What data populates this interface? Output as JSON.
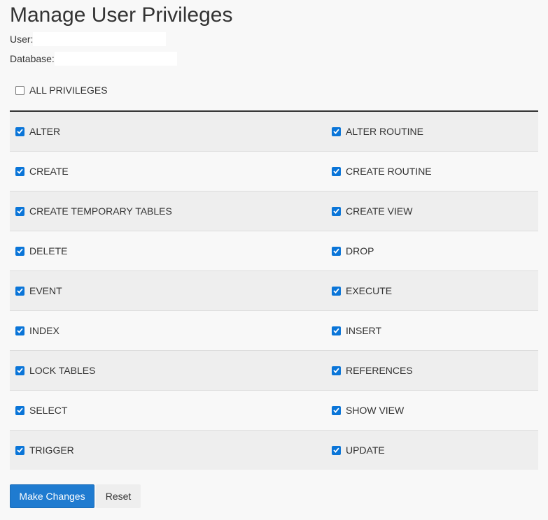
{
  "page": {
    "title": "Manage User Privileges"
  },
  "info": {
    "user_label": "User:",
    "user_value": "",
    "database_label": "Database:",
    "database_value": ""
  },
  "all_privileges": {
    "label": "ALL PRIVILEGES",
    "checked": false
  },
  "privileges": [
    {
      "left": {
        "label": "ALTER",
        "checked": true
      },
      "right": {
        "label": "ALTER ROUTINE",
        "checked": true
      }
    },
    {
      "left": {
        "label": "CREATE",
        "checked": true
      },
      "right": {
        "label": "CREATE ROUTINE",
        "checked": true
      }
    },
    {
      "left": {
        "label": "CREATE TEMPORARY TABLES",
        "checked": true
      },
      "right": {
        "label": "CREATE VIEW",
        "checked": true
      }
    },
    {
      "left": {
        "label": "DELETE",
        "checked": true
      },
      "right": {
        "label": "DROP",
        "checked": true
      }
    },
    {
      "left": {
        "label": "EVENT",
        "checked": true
      },
      "right": {
        "label": "EXECUTE",
        "checked": true
      }
    },
    {
      "left": {
        "label": "INDEX",
        "checked": true
      },
      "right": {
        "label": "INSERT",
        "checked": true
      }
    },
    {
      "left": {
        "label": "LOCK TABLES",
        "checked": true
      },
      "right": {
        "label": "REFERENCES",
        "checked": true
      }
    },
    {
      "left": {
        "label": "SELECT",
        "checked": true
      },
      "right": {
        "label": "SHOW VIEW",
        "checked": true
      }
    },
    {
      "left": {
        "label": "TRIGGER",
        "checked": true
      },
      "right": {
        "label": "UPDATE",
        "checked": true
      }
    }
  ],
  "buttons": {
    "submit_label": "Make Changes",
    "reset_label": "Reset"
  },
  "colors": {
    "checkbox_checked": "#0a75d8",
    "primary_button": "#1f7bd0"
  }
}
